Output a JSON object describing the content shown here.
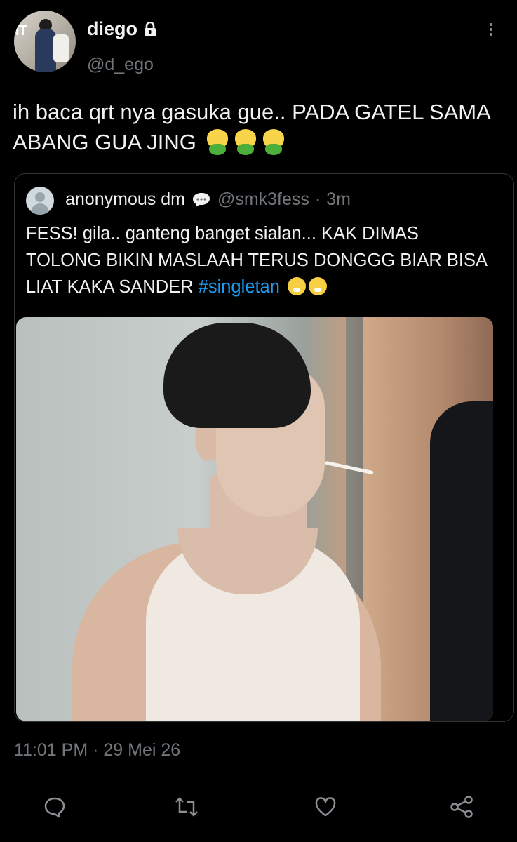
{
  "author": {
    "name": "diego",
    "handle": "@d_ego",
    "avatar_text": "IT",
    "icons": [
      "lock-icon",
      "more-options-icon"
    ]
  },
  "tweet": {
    "text": "ih baca qrt nya gasuka gue.. PADA GATEL SAMA ABANG GUA JING",
    "emojis": [
      "face-vomiting",
      "face-vomiting",
      "face-vomiting"
    ],
    "timestamp": "11:01 PM",
    "date_separator": "·",
    "date": "29 Mei 26"
  },
  "quoted": {
    "name": "anonymous dm",
    "handle": "@smk3fess",
    "separator": "·",
    "time": "3m",
    "text_before": "FESS! gila.. ganteng banget sialan... KAK DIMAS TOLONG BIKIN MASLAAH TERUS DONGGG BIAR BISA LIAT KAKA SANDER ",
    "hashtag": "#singletan",
    "emojis": [
      "face-exhaling",
      "face-exhaling"
    ],
    "hashtag_color": "#1d9bf0"
  },
  "actions": {
    "icons": [
      "reply-icon",
      "retweet-icon",
      "like-icon",
      "share-icon"
    ]
  },
  "colors": {
    "background": "#000000",
    "text": "#e7e9ea",
    "muted": "#71767b",
    "border": "#2f3336"
  }
}
